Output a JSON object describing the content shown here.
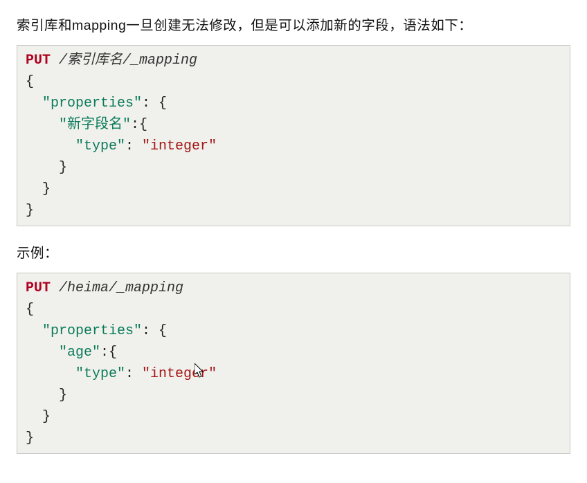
{
  "intro": "索引库和mapping一旦创建无法修改，但是可以添加新的字段，语法如下：",
  "example_label": "示例：",
  "block1": {
    "method": "PUT",
    "path": " /索引库名/_mapping",
    "props_key": "\"properties\"",
    "field_key": "\"新字段名\"",
    "type_key": "\"type\"",
    "type_val": "\"integer\"",
    "brace_open": "{",
    "brace_close": "}",
    "colon_brace": ": {",
    "colon_brace2": ":{",
    "colon_space": ": "
  },
  "block2": {
    "method": "PUT",
    "path": " /heima/_mapping",
    "props_key": "\"properties\"",
    "field_key": "\"age\"",
    "type_key": "\"type\"",
    "type_val": "\"integer\"",
    "brace_open": "{",
    "brace_close": "}",
    "colon_brace": ": {",
    "colon_brace2": ":{",
    "colon_space": ": "
  }
}
